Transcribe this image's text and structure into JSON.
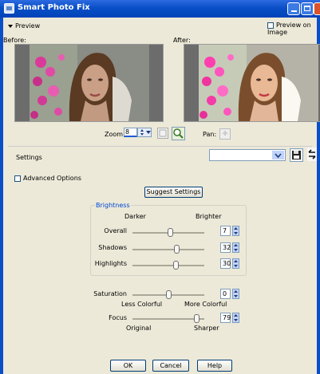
{
  "window": {
    "title": "Smart Photo Fix"
  },
  "preview": {
    "toggle_label": "Preview",
    "preview_on_image_label": "Preview on Image",
    "before_label": "Before:",
    "after_label": "After:"
  },
  "zoom": {
    "label": "Zoom:",
    "value": "8",
    "pan_label": "Pan:"
  },
  "settings": {
    "label": "Settings",
    "selected": ""
  },
  "advanced": {
    "label": "Advanced Options",
    "suggest_label": "Suggest Settings"
  },
  "brightness": {
    "title": "Brightness",
    "darker_label": "Darker",
    "brighter_label": "Brighter",
    "overall": {
      "label": "Overall",
      "value": "7",
      "level": 0.53
    },
    "shadows": {
      "label": "Shadows",
      "value": "32",
      "level": 0.62
    },
    "highlights": {
      "label": "Highlights",
      "value": "30",
      "level": 0.61
    }
  },
  "saturation": {
    "label": "Saturation",
    "value": "0",
    "level": 0.5,
    "left_label": "Less Colorful",
    "right_label": "More Colorful"
  },
  "focus": {
    "label": "Focus",
    "value": "79",
    "level": 0.89,
    "left_label": "Original",
    "right_label": "Sharper"
  },
  "buttons": {
    "ok": "OK",
    "cancel": "Cancel",
    "help": "Help"
  },
  "colors": {
    "titlebar": "#0a4fc7",
    "accent": "#0046d5"
  }
}
